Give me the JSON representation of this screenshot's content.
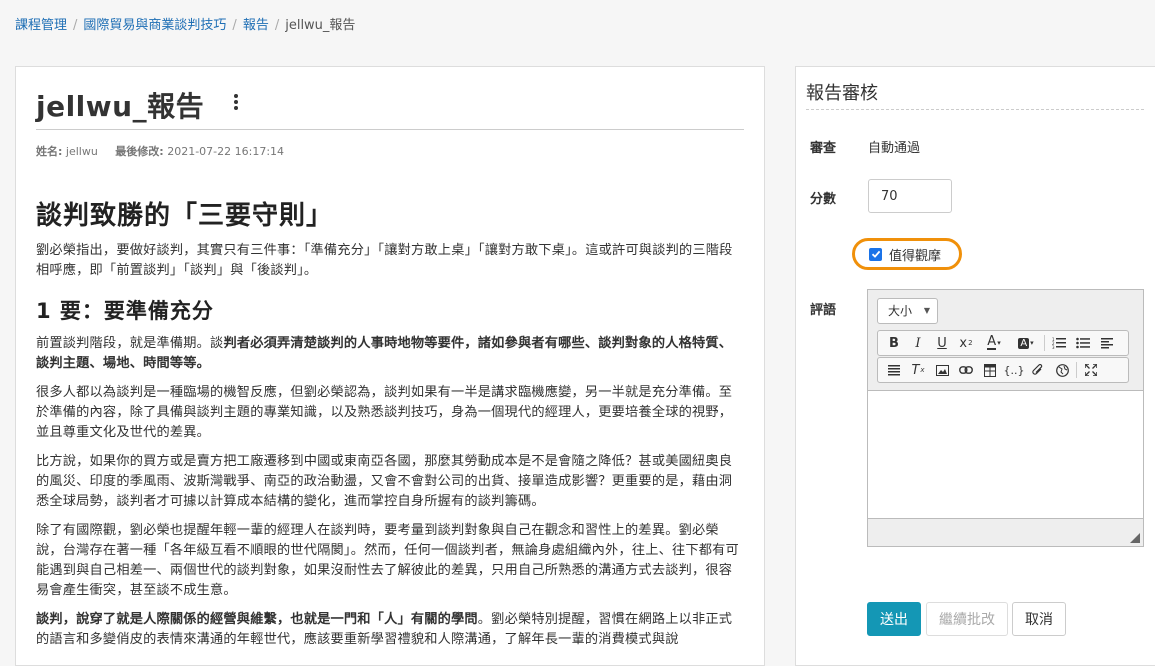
{
  "breadcrumb": {
    "items": [
      "課程管理",
      "國際貿易與商業談判技巧",
      "報告"
    ],
    "current": "jellwu_報告"
  },
  "document": {
    "title": "jellwu_報告",
    "meta": {
      "author_label": "姓名:",
      "author": "jellwu",
      "modified_label": "最後修改:",
      "modified": "2021-07-22 16:17:14"
    },
    "heading1": "談判致勝的「三要守則」",
    "intro": "劉必榮指出，要做好談判，其實只有三件事：「準備充分」「讓對方敢上桌」「讓對方敢下桌」。這或許可與談判的三階段相呼應，即「前置談判」「談判」與「後談判」。",
    "heading2": "1 要：要準備充分",
    "p1_normal": "前置談判階段，就是準備期。談",
    "p1_bold": "判者必須弄清楚談判的人事時地物等要件，諸如參與者有哪些、談判對象的人格特質、談判主題、場地、時間等等。",
    "p2": "很多人都以為談判是一種臨場的機智反應，但劉必榮認為，談判如果有一半是講求臨機應變，另一半就是充分準備。至於準備的內容，除了具備與談判主題的專業知識，以及熟悉談判技巧，身為一個現代的經理人，更要培養全球的視野，並且尊重文化及世代的差異。",
    "p3": "比方說，如果你的買方或是賣方把工廠遷移到中國或東南亞各國，那麼其勞動成本是不是會隨之降低？甚或美國紐奧良的風災、印度的季風雨、波斯灣戰爭、南亞的政治動盪，又會不會對公司的出貨、接單造成影響？更重要的是，藉由洞悉全球局勢，談判者才可據以計算成本結構的變化，進而掌控自身所握有的談判籌碼。",
    "p4": "除了有國際觀，劉必榮也提醒年輕一輩的經理人在談判時，要考量到談判對象與自己在觀念和習性上的差異。劉必榮說，台灣存在著一種「各年級互看不順眼的世代隔閡」。然而，任何一個談判者，無論身處組織內外，往上、往下都有可能遇到與自己相差一、兩個世代的談判對象，如果沒耐性去了解彼此的差異，只用自己所熟悉的溝通方式去談判，很容易會產生衝突，甚至談不成生意。",
    "p5_bold": "談判，說穿了就是人際關係的經營與維繫，也就是一門和「人」有關的學問",
    "p5_normal": "。劉必榮特別提醒，習慣在網路上以非正式的語言和多變俏皮的表情來溝通的年輕世代，應該要重新學習禮貌和人際溝通，了解年長一輩的消費模式與說"
  },
  "review": {
    "title": "報告審核",
    "review_label": "審查",
    "review_value": "自動通過",
    "score_label": "分數",
    "score_value": "70",
    "featured_label": "值得觀摩",
    "featured_checked": true,
    "comment_label": "評語",
    "editor": {
      "size_label": "大小",
      "toolbar_row1": [
        "bold-icon",
        "italic-icon",
        "underline-icon",
        "superscript-icon",
        "text-color-icon",
        "background-color-icon",
        "numbered-list-icon",
        "bulleted-list-icon",
        "align-left-icon"
      ],
      "toolbar_row2": [
        "justify-icon",
        "remove-format-icon",
        "image-icon",
        "link-icon",
        "table-icon",
        "code-snippet-icon",
        "attachment-icon",
        "globe-icon",
        "maximize-icon"
      ]
    },
    "buttons": {
      "submit": "送出",
      "continue": "繼續批改",
      "cancel": "取消"
    }
  },
  "colors": {
    "accent": "#1497b5",
    "link": "#1f6fb5",
    "highlight": "#f0900a",
    "checkbox": "#1a73e8"
  }
}
